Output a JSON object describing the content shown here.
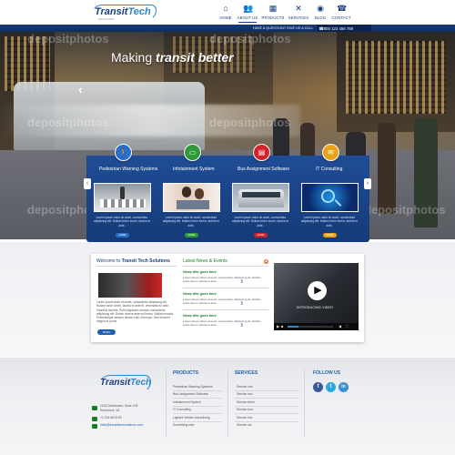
{
  "header": {
    "logo": {
      "word_a": "Transit",
      "word_b": "Tech",
      "tagline": "SOLUTIONS"
    },
    "nav": [
      {
        "label": "HOME",
        "icon": "home-icon"
      },
      {
        "label": "ABOUT US",
        "icon": "users-icon"
      },
      {
        "label": "PRODUCTS",
        "icon": "grid-icon"
      },
      {
        "label": "SERVICES",
        "icon": "tools-icon"
      },
      {
        "label": "BLOG",
        "icon": "rss-icon"
      },
      {
        "label": "CONTACT",
        "icon": "phone-icon"
      }
    ],
    "active_nav": "ABOUT US",
    "question": "HAVE A QUESTION? GIVE US A CALL",
    "phone": "800 123 456 789"
  },
  "hero": {
    "title_plain": "Making ",
    "title_em": "transit better",
    "watermark": "depositphotos"
  },
  "services": [
    {
      "title": "Pedestrian Warning Systems",
      "color": "#2a6ec9",
      "icon": "pedestrian-icon",
      "button": "MORE",
      "button_color": "#2a6ec9",
      "text": "Lorem ipsum dolor sit amet, consectetur adipiscing elit. Nullam tortor lorem, lacinia et ante."
    },
    {
      "title": "Infotainment System",
      "color": "#2f9a3a",
      "icon": "monitor-icon",
      "button": "MORE",
      "button_color": "#2f9a3a",
      "text": "Lorem ipsum dolor sit amet, consectetur adipiscing elit. Nullam tortor lorem, lacinia et ante."
    },
    {
      "title": "Bus Assignment Software",
      "color": "#d4222a",
      "icon": "bus-icon",
      "button": "MORE",
      "button_color": "#d4222a",
      "text": "Lorem ipsum dolor sit amet, consectetur adipiscing elit. Nullam tortor lorem, lacinia et ante."
    },
    {
      "title": "IT Consulting",
      "color": "#e8a31a",
      "icon": "chat-icon",
      "button": "MORE",
      "button_color": "#e8a31a",
      "text": "Lorem ipsum dolor sit amet, consectetur adipiscing elit. Nullam tortor lorem, lacinia et ante."
    }
  ],
  "welcome": {
    "prefix": "Welcome to ",
    "name": "Transit Tech Solutions",
    "text": "Lorem ipsum dolor sit amet, consectetur adipiscing elit. Nullam tortor lorem, lacinia et ante et, venenatis eu ante. Vivamus lobortis. Proin dignissim semper consectetur adipiscing elit. Donec viverra ante vel lectus. Nullam mauris. Pellentesque semper dictum odio id tempor. Sed sit amet magna et purus.",
    "button": "MORE"
  },
  "news": {
    "prefix": "Latest ",
    "name": "News & Events",
    "items": [
      {
        "title": "News title goes here",
        "text": "Lorem ipsum dolor sit amet, consectetur adipiscing elit. Nullam tortor lorem, lacinia et ante."
      },
      {
        "title": "News title goes here",
        "text": "Lorem ipsum dolor sit amet, consectetur adipiscing elit. Nullam tortor lorem, lacinia et ante."
      },
      {
        "title": "News title goes here",
        "text": "Lorem ipsum dolor sit amet, consectetur adipiscing elit. Nullam tortor lorem, lacinia et ante."
      }
    ]
  },
  "video": {
    "label": "INTRODUCING VIDEO",
    "progress": 0.24
  },
  "footer": {
    "logo": {
      "word_a": "Transit",
      "word_b": "Tech"
    },
    "address_1": "1125 Drivetowne, Suite 105",
    "address_2": "Richmond, VA",
    "phone": "+1 234 5678 90",
    "email": "hello@transittechsolutions.com",
    "products_title": "PRODUCTS",
    "products": [
      "Pedestrian Warning Systems",
      "Bus Assignment Software",
      "Infotainment System",
      "IT Consulting",
      "Lighted Vehicle Advertising",
      "Something else"
    ],
    "services_title": "SERVICES",
    "services": [
      "Service one",
      "Service two",
      "Service three",
      "Service four",
      "Service five",
      "Service six"
    ],
    "follow_title": "FOLLOW US",
    "social": [
      {
        "name": "facebook",
        "glyph": "f",
        "color": "#3b5998"
      },
      {
        "name": "twitter",
        "glyph": "t",
        "color": "#2aa9e0"
      },
      {
        "name": "linkedin",
        "glyph": "in",
        "color": "#3d8fd0"
      }
    ]
  }
}
